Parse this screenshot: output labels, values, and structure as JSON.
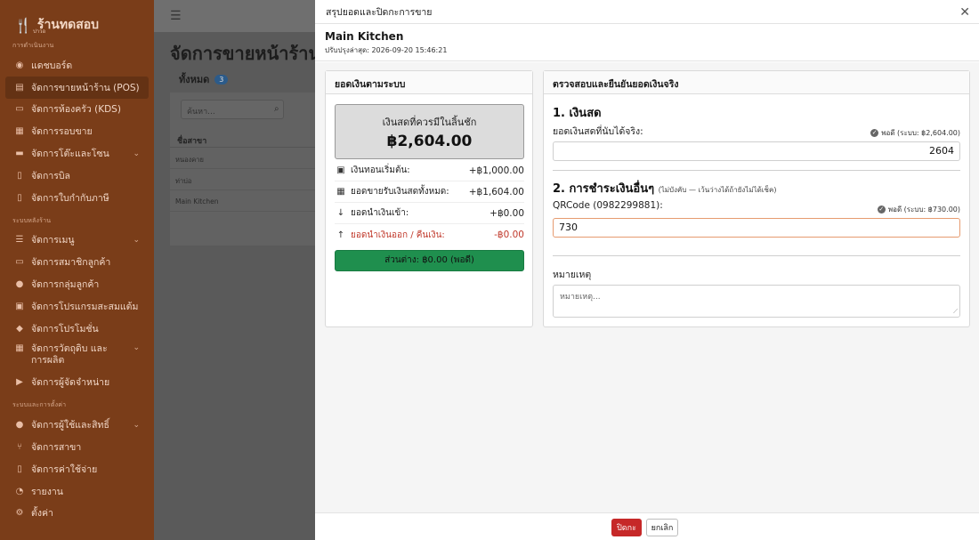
{
  "sidebar": {
    "brand_name": "ร้านทดสอบ",
    "brand_sub": "ปาวอ",
    "sections": {
      "ops": "การดำเนินงาน",
      "backoffice": "ระบบหลังร้าน",
      "settings": "ระบบและการตั้งค่า"
    },
    "items": [
      {
        "label": "แดชบอร์ด",
        "icon": "dashboard-icon"
      },
      {
        "label": "จัดการขายหน้าร้าน (POS)",
        "icon": "cart-icon"
      },
      {
        "label": "จัดการห้องครัว (KDS)",
        "icon": "monitor-icon"
      },
      {
        "label": "จัดการรอบขาย",
        "icon": "calendar-icon"
      },
      {
        "label": "จัดการโต๊ะและโซน",
        "icon": "table-icon"
      },
      {
        "label": "จัดการบิล",
        "icon": "receipt-icon"
      },
      {
        "label": "จัดการใบกำกับภาษี",
        "icon": "invoice-icon"
      },
      {
        "label": "จัดการเมนู",
        "icon": "menu-icon"
      },
      {
        "label": "จัดการสมาชิกลูกค้า",
        "icon": "member-card-icon"
      },
      {
        "label": "จัดการกลุ่มลูกค้า",
        "icon": "users-icon"
      },
      {
        "label": "จัดการโปรแกรมสะสมแต้ม",
        "icon": "points-icon"
      },
      {
        "label": "จัดการโปรโมชั่น",
        "icon": "tag-icon"
      },
      {
        "label": "จัดการวัตถุดิบ และการผลิต",
        "icon": "box-icon"
      },
      {
        "label": "จัดการผู้จัดจำหน่าย",
        "icon": "truck-icon"
      },
      {
        "label": "จัดการผู้ใช้และสิทธิ์",
        "icon": "user-group-icon"
      },
      {
        "label": "จัดการสาขา",
        "icon": "branch-icon"
      },
      {
        "label": "จัดการค่าใช้จ่าย",
        "icon": "expense-icon"
      },
      {
        "label": "รายงาน",
        "icon": "report-icon"
      },
      {
        "label": "ตั้งค่า",
        "icon": "gear-icon"
      }
    ]
  },
  "page": {
    "title": "จัดการขายหน้าร้าน (P",
    "tab_label": "ทั้งหมด",
    "tab_count": "3",
    "search_placeholder": "ค้นหา...",
    "table_header": "ชื่อสาขา",
    "rows": [
      "หนองคาย",
      "ท่าบ่อ",
      "Main Kitchen"
    ]
  },
  "modal": {
    "title": "สรุปยอดและปิดกะการขาย",
    "branch": "Main Kitchen",
    "updated": "ปรับปรุงล่าสุด: 2026-09-20 15:46:21",
    "left": {
      "heading": "ยอดเงินตามระบบ",
      "expected_label": "เงินสดที่ควรมีในลิ้นชัก",
      "expected_value": "฿2,604.00",
      "rows": [
        {
          "label": "เงินทอนเริ่มต้น:",
          "value": "+฿1,000.00",
          "icon": "money-icon"
        },
        {
          "label": "ยอดขายรับเงินสดทั้งหมด:",
          "value": "+฿1,604.00",
          "icon": "cash-register-icon"
        },
        {
          "label": "ยอดนำเงินเข้า:",
          "value": "+฿0.00",
          "icon": "arrow-down-icon"
        },
        {
          "label": "ยอดนำเงินออก / คืนเงิน:",
          "value": "-฿0.00",
          "icon": "arrow-up-icon"
        }
      ],
      "diff": "ส่วนต่าง: ฿0.00 (พอดี)"
    },
    "right": {
      "heading": "ตรวจสอบและยืนยันยอดเงินจริง",
      "cash_section": "1. เงินสด",
      "cash_label": "ยอดเงินสดที่นับได้จริง:",
      "cash_match": "พอดี (ระบบ: ฿2,604.00)",
      "cash_value": "2604",
      "other_section": "2. การชำระเงินอื่นๆ",
      "other_note": "(ไม่บังคับ — เว้นว่างได้ถ้ายังไม่ได้เช็ค)",
      "qr_label": "QRCode (0982299881):",
      "qr_match": "พอดี (ระบบ: ฿730.00)",
      "qr_value": "730",
      "note_label": "หมายเหตุ",
      "note_placeholder": "หมายเหตุ..."
    },
    "footer": {
      "close_label": "ปิดกะ",
      "cancel_label": "ยกเลิก"
    }
  },
  "colors": {
    "sidebar": "#7a3d19",
    "diff_bar": "#1f8f4e",
    "close_button": "#c62828",
    "refund_text": "#c0392b"
  }
}
